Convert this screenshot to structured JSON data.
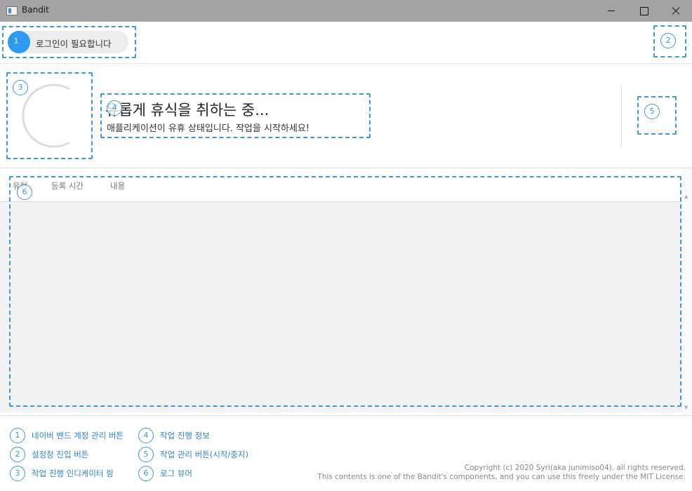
{
  "window": {
    "title": "Bandit"
  },
  "login": {
    "label": "로그인이 필요합니다"
  },
  "status": {
    "title": "유롭게 휴식을 취하는 중...",
    "description": "애플리케이션이 유휴 상태입니다. 작업을 시작하세요!"
  },
  "log": {
    "columns": [
      "유형",
      "등록 시간",
      "내용"
    ],
    "rows": []
  },
  "markers": [
    "1",
    "2",
    "3",
    "4",
    "5",
    "6"
  ],
  "legend": [
    {
      "num": "1",
      "text": "네이버 밴드 계정 관리 버튼"
    },
    {
      "num": "2",
      "text": "설정창 진입 버튼"
    },
    {
      "num": "3",
      "text": "작업 진행 인디케이터 링"
    },
    {
      "num": "4",
      "text": "작업 진행 정보"
    },
    {
      "num": "5",
      "text": "작업 관리 버튼(시작/중지)"
    },
    {
      "num": "6",
      "text": "로그 뷰어"
    }
  ],
  "copyright": {
    "line1": "Copyright (c) 2020 Syri(aka junimiso04). all rights reserved.",
    "line2": "This contents is one of the Bandit's components, and you can use this freely under the MIT License."
  },
  "colors": {
    "accent": "#2b9af0",
    "annotation": "#3d97d8",
    "titlebar": "#a3a3a3"
  }
}
